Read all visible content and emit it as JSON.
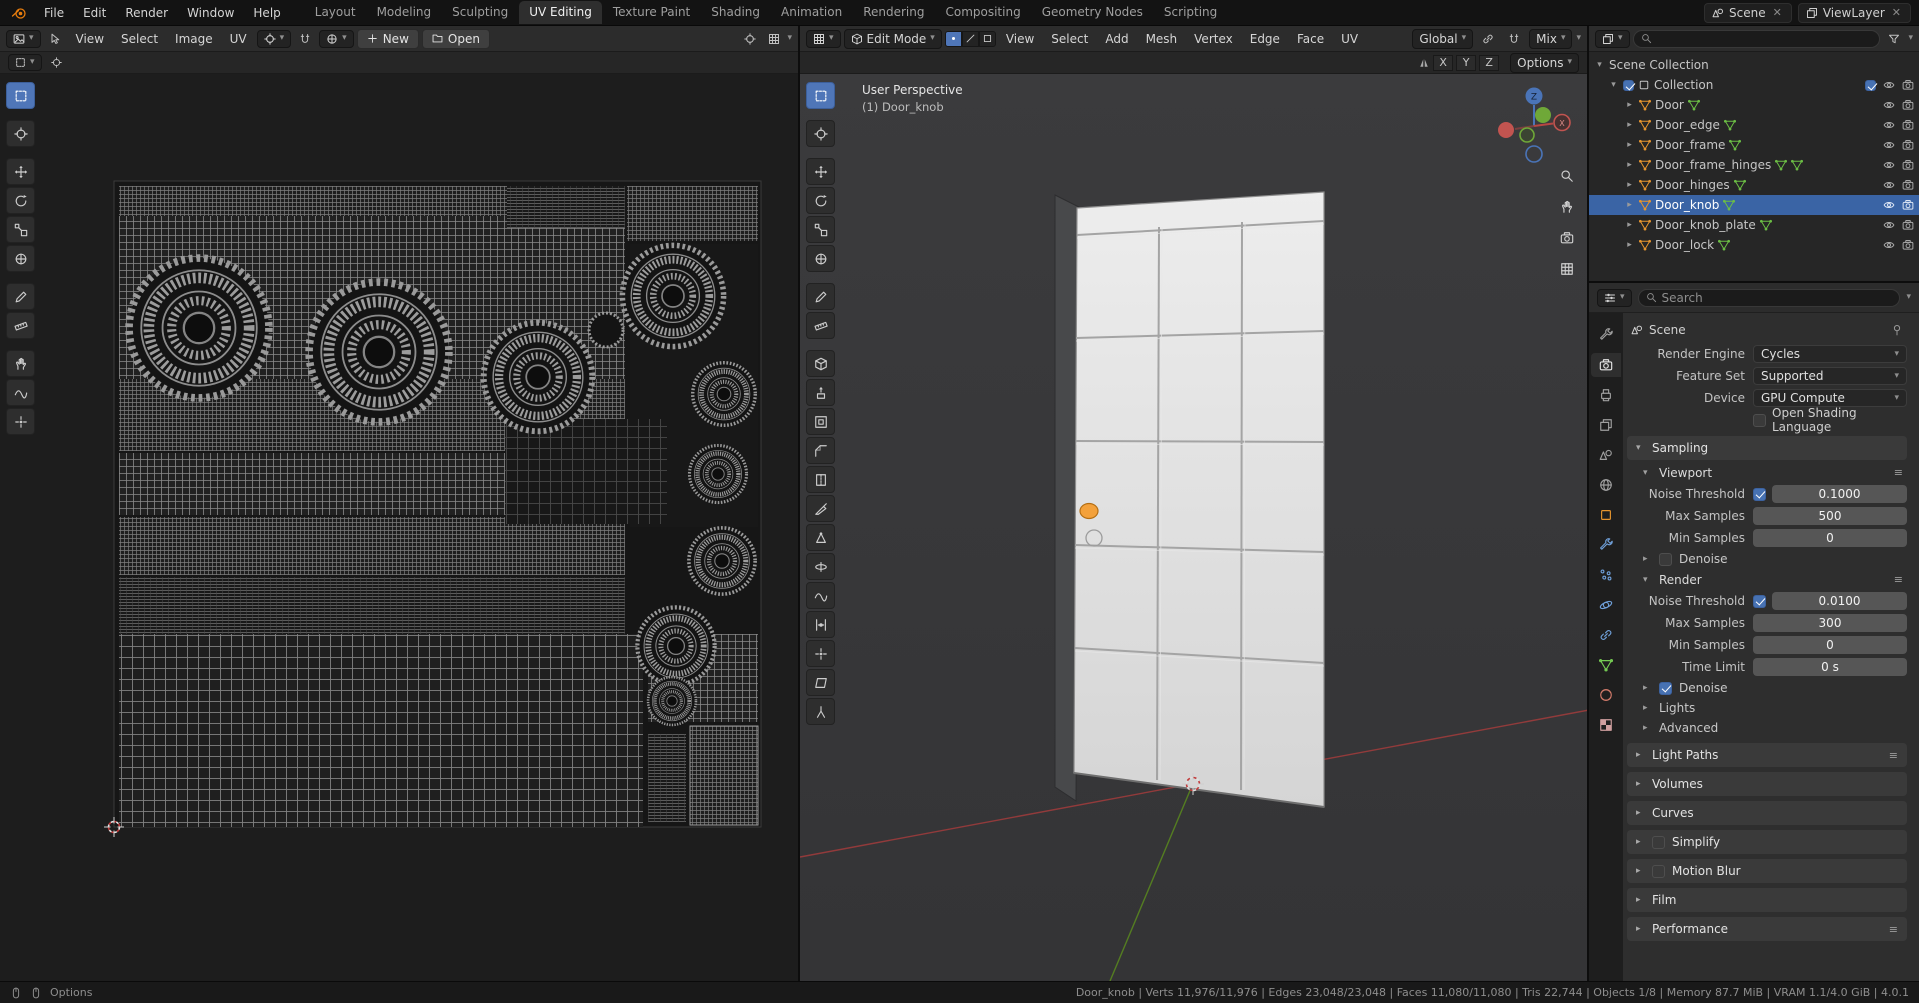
{
  "topbar": {
    "menus": [
      "File",
      "Edit",
      "Render",
      "Window",
      "Help"
    ],
    "tabs": [
      "Layout",
      "Modeling",
      "Sculpting",
      "UV Editing",
      "Texture Paint",
      "Shading",
      "Animation",
      "Rendering",
      "Compositing",
      "Geometry Nodes",
      "Scripting"
    ],
    "active_tab": "UV Editing",
    "scene_label": "Scene",
    "viewlayer_label": "ViewLayer"
  },
  "uv_editor": {
    "menus": [
      "View",
      "Select",
      "Image",
      "UV"
    ],
    "new_label": "New",
    "open_label": "Open",
    "tools": [
      "select-box",
      "cursor",
      "move",
      "rotate",
      "scale",
      "transform",
      "annotate",
      "measure",
      "grab",
      "relax",
      "pinch"
    ]
  },
  "viewport": {
    "mode": "Edit Mode",
    "menus": [
      "View",
      "Select",
      "Add",
      "Mesh",
      "Vertex",
      "Edge",
      "Face",
      "UV"
    ],
    "orientation": "Global",
    "falloff": "Mix",
    "mirror_label_x": "X",
    "mirror_label_y": "Y",
    "mirror_label_z": "Z",
    "options_label": "Options",
    "overlay_line1": "User Perspective",
    "overlay_line2": "(1) Door_knob",
    "gizmo_z": "Z",
    "gizmo_x": "X",
    "tools": [
      "select-box",
      "cursor",
      "move",
      "rotate",
      "scale",
      "transform",
      "annotate",
      "measure",
      "add-cube",
      "extrude-region",
      "inset-faces",
      "bevel",
      "loop-cut",
      "knife",
      "poly-build",
      "spin",
      "smooth",
      "edge-slide",
      "shrink-fatten",
      "shear",
      "rip-region",
      "rip-edge"
    ]
  },
  "outliner": {
    "rows": [
      "Scene Collection",
      "Collection",
      "Door",
      "Door_edge",
      "Door_frame",
      "Door_frame_hinges",
      "Door_hinges",
      "Door_knob",
      "Door_knob_plate",
      "Door_lock"
    ],
    "selected_row": "Door_knob"
  },
  "properties": {
    "search_placeholder": "Search",
    "breadcrumb": "Scene",
    "tabs": [
      "tool",
      "render",
      "output",
      "view-layer",
      "scene",
      "world",
      "object",
      "modifiers",
      "particles",
      "physics",
      "constraints",
      "data",
      "material",
      "texture"
    ],
    "active_tab": "render",
    "rows": {
      "render_engine": {
        "label": "Render Engine",
        "value": "Cycles"
      },
      "feature_set": {
        "label": "Feature Set",
        "value": "Supported"
      },
      "device": {
        "label": "Device",
        "value": "GPU Compute"
      },
      "osl": {
        "label": "Open Shading Language"
      }
    },
    "sampling": {
      "title": "Sampling",
      "viewport": {
        "title": "Viewport",
        "noise_threshold": {
          "label": "Noise Threshold",
          "value": "0.1000"
        },
        "max_samples": {
          "label": "Max Samples",
          "value": "500"
        },
        "min_samples": {
          "label": "Min Samples",
          "value": "0"
        },
        "denoise_label": "Denoise"
      },
      "render": {
        "title": "Render",
        "noise_threshold": {
          "label": "Noise Threshold",
          "value": "0.0100"
        },
        "max_samples": {
          "label": "Max Samples",
          "value": "300"
        },
        "min_samples": {
          "label": "Min Samples",
          "value": "0"
        },
        "time_limit": {
          "label": "Time Limit",
          "value": "0 s"
        }
      },
      "denoise_label": "Denoise",
      "lights_label": "Lights",
      "advanced_label": "Advanced"
    },
    "sections": {
      "light_paths": "Light Paths",
      "volumes": "Volumes",
      "curves": "Curves",
      "simplify": "Simplify",
      "motion_blur": "Motion Blur",
      "film": "Film",
      "performance": "Performance"
    }
  },
  "statusbar": {
    "left_label": "Options",
    "stats": "Door_knob | Verts 11,976/11,976 | Edges 23,048/23,048 | Faces 11,080/11,080 | Tris 22,744 | Objects 1/8 | Memory 87.7 MiB | VRAM 1.1/4.0 GiB | 4.0.1"
  },
  "colors": {
    "accent_blue": "#4772b3",
    "selection_orange": "#f3a13b",
    "axis_x": "#a33c3c",
    "axis_y": "#5a8a1e",
    "axis_z": "#4a74b8"
  }
}
